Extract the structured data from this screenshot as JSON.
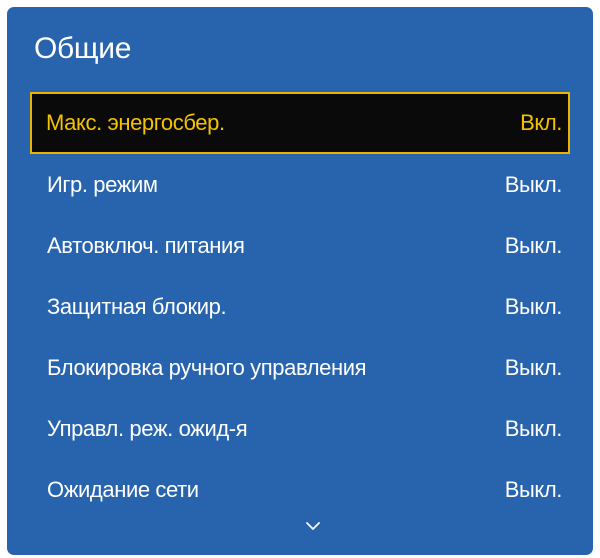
{
  "menu": {
    "title": "Общие",
    "items": [
      {
        "label": "Макс. энергосбер.",
        "value": "Вкл.",
        "selected": true
      },
      {
        "label": "Игр. режим",
        "value": "Выкл.",
        "selected": false
      },
      {
        "label": "Автовключ. питания",
        "value": "Выкл.",
        "selected": false
      },
      {
        "label": "Защитная блокир.",
        "value": "Выкл.",
        "selected": false
      },
      {
        "label": "Блокировка ручного управления",
        "value": "Выкл.",
        "selected": false
      },
      {
        "label": "Управл. реж. ожид-я",
        "value": "Выкл.",
        "selected": false
      },
      {
        "label": "Ожидание сети",
        "value": "Выкл.",
        "selected": false
      }
    ],
    "scroll_icon": "chevron-down-icon"
  },
  "colors": {
    "panel_background": "#2864ae",
    "text": "#ffffff",
    "selected_background": "#0a0a0a",
    "selected_text": "#f4c200",
    "selected_border": "#e8b400"
  }
}
